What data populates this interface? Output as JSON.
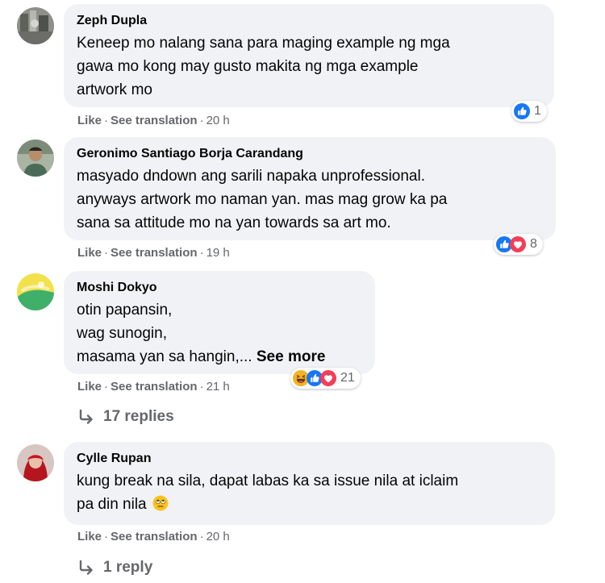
{
  "comments": [
    {
      "author": "Zeph Dupla",
      "lines": [
        "Keneep mo nalang sana para maging example ng mga",
        "gawa mo kong may gusto makita ng mga example",
        "artwork mo"
      ],
      "actions": {
        "like": "Like",
        "translate": "See translation",
        "time": "20 h"
      },
      "reactions": {
        "icons": [
          "like-icon"
        ],
        "count": "1"
      }
    },
    {
      "author": "Geronimo Santiago Borja Carandang",
      "lines": [
        "masyado dndown ang sarili napaka unprofessional.",
        "anyways artwork mo naman yan. mas mag grow ka pa",
        "sana sa attitude mo na yan towards sa art mo."
      ],
      "actions": {
        "like": "Like",
        "translate": "See translation",
        "time": "19 h"
      },
      "reactions": {
        "icons": [
          "like-icon",
          "love-icon"
        ],
        "count": "8"
      }
    },
    {
      "author": "Moshi Dokyo",
      "lines": [
        "otin papansin,",
        "wag sunogin,",
        "masama yan sa hangin,..."
      ],
      "see_more": "See more",
      "actions": {
        "like": "Like",
        "translate": "See translation",
        "time": "21 h"
      },
      "reactions": {
        "icons": [
          "haha-icon",
          "like-icon",
          "love-icon"
        ],
        "count": "21"
      },
      "replies": "17 replies"
    },
    {
      "author": "Cylle Rupan",
      "lines": [
        "kung break na sila, dapat labas ka sa issue nila at iclaim",
        "pa din nila"
      ],
      "actions": {
        "like": "Like",
        "translate": "See translation",
        "time": "20 h"
      },
      "replies": "1 reply"
    }
  ],
  "colors": {
    "bubble": "#f0f2f5",
    "meta": "#65676b",
    "like": "#1877f2",
    "love": "#f33e58",
    "haha": "#f7b125"
  }
}
